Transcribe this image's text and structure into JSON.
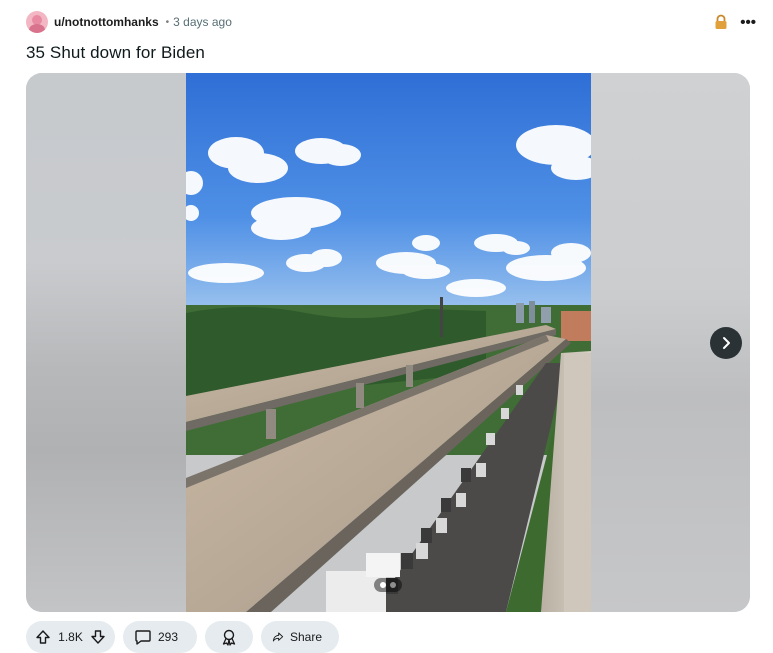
{
  "post": {
    "author": "u/notnottomhanks",
    "separator": "•",
    "time": "3 days ago",
    "title": "35 Shut down for Biden",
    "more_label": "•••"
  },
  "media": {
    "slide_count": 2,
    "active_slide": 1
  },
  "actions": {
    "vote_count": "1.8K",
    "comment_count": "293",
    "share_label": "Share"
  },
  "colors": {
    "accent_lock": "#c9892b",
    "pill_bg": "#e5ebee",
    "next_button": "#2a3236"
  },
  "icons": [
    "avatar",
    "lock-icon",
    "more-icon",
    "chevron-right-icon",
    "upvote-icon",
    "downvote-icon",
    "comment-icon",
    "award-icon",
    "share-icon"
  ]
}
